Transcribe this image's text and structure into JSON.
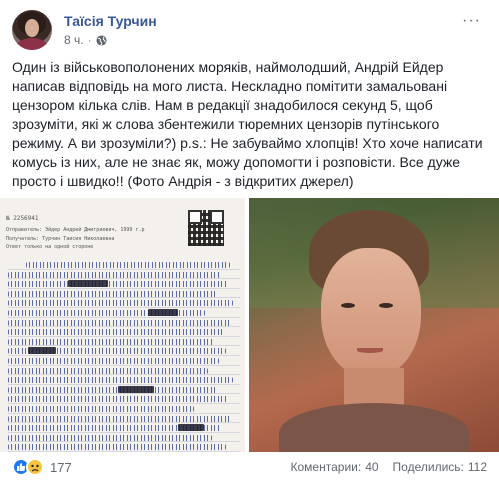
{
  "post": {
    "author": "Таїсія Турчин",
    "time": "8 ч.",
    "separator": "·",
    "more": "···",
    "text": "Один із військовополонених моряків, наймолодший, Андрій Ейдер написав відповідь на мого листа. Нескладно помітити замальовані цензором кілька слів. Нам в редакції знадобилося секунд 5, щоб зрозуміти, які ж слова збентежили тюремних цензорів путінського режиму. А ви зрозуміли?) p.s.: Не забуваймо хлопців! Хто хоче написати комусь із них, але не знає як, можу допомогти і розповісти. Все дуже просто і швидко!! (Фото Андрія - з відкритих джерел)"
  },
  "letter": {
    "number": "№ 2256941",
    "sender": "Отправитель: Эйдер Андрей Дмитриевич, 1999 г.р",
    "recipient": "Получатель: Турчин Таисия Николаевна",
    "reply_note": "Ответ только на одной стороне"
  },
  "footer": {
    "reactions_count": "177",
    "comments_label": "Коментарии:",
    "comments_count": "40",
    "shares_label": "Поделились:",
    "shares_count": "112"
  },
  "colors": {
    "author_link": "#385898",
    "like": "#2078f4",
    "sad": "#f7c33b",
    "ink": "#2a3d9b"
  },
  "icons": {
    "privacy": "globe-icon",
    "like": "like-reaction-icon",
    "sad": "sad-reaction-icon"
  }
}
